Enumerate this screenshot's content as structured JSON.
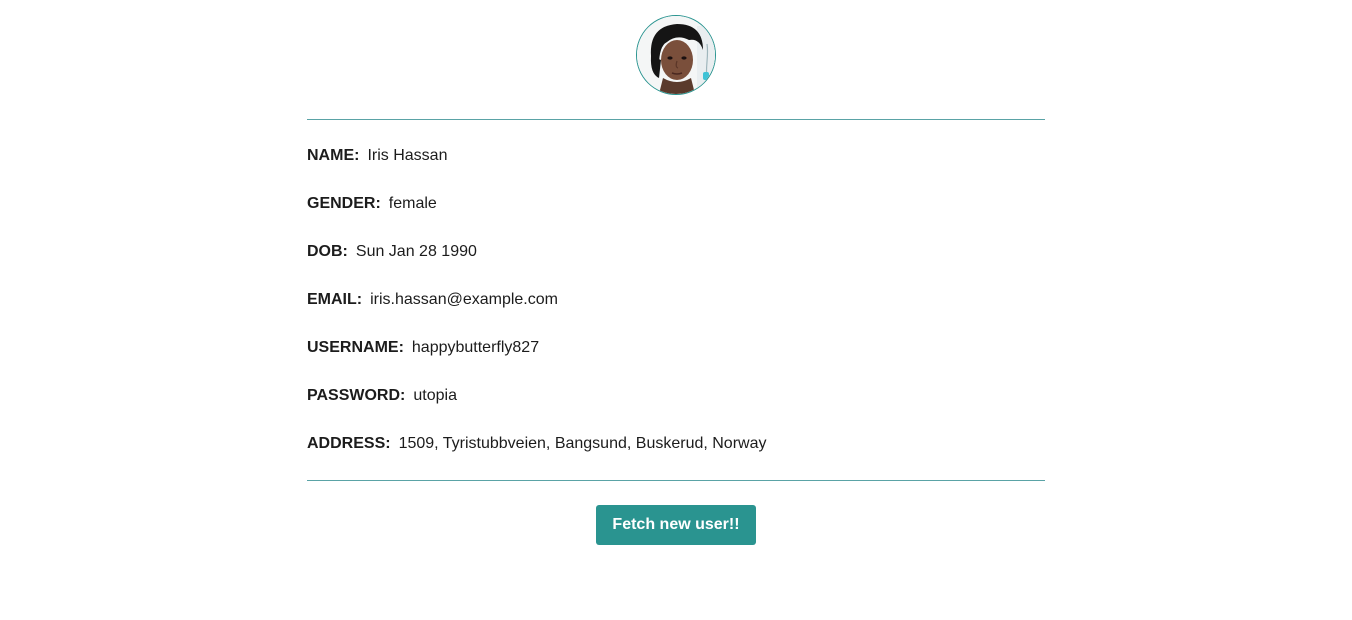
{
  "user": {
    "fields": [
      {
        "label": "NAME:",
        "value": "Iris Hassan"
      },
      {
        "label": "GENDER:",
        "value": "female"
      },
      {
        "label": "DOB:",
        "value": "Sun Jan 28 1990"
      },
      {
        "label": "EMAIL:",
        "value": "iris.hassan@example.com"
      },
      {
        "label": "USERNAME:",
        "value": "happybutterfly827"
      },
      {
        "label": "PASSWORD:",
        "value": "utopia"
      },
      {
        "label": "ADDRESS:",
        "value": "1509, Tyristubbveien, Bangsund, Buskerud, Norway"
      }
    ]
  },
  "actions": {
    "fetch_label": "Fetch new user!!"
  },
  "colors": {
    "accent": "#2a9490",
    "divider": "#5aa3a6",
    "text": "#1c1c1c",
    "background": "#ffffff"
  }
}
